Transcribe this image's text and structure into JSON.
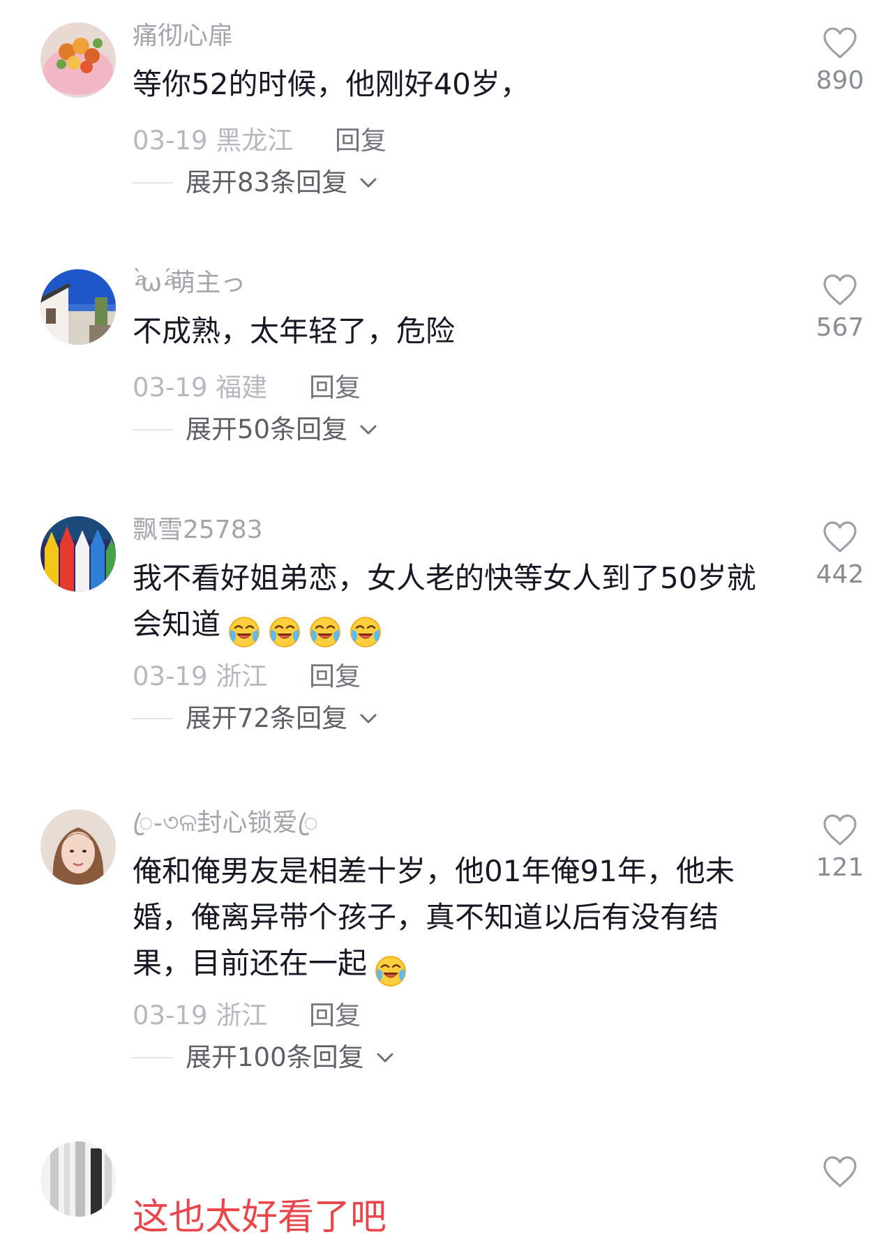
{
  "comments": [
    {
      "username": "痛彻心扉",
      "text": "等你52的时候，他刚好40岁，",
      "date": "03-19",
      "location": "黑龙江",
      "reply": "回复",
      "expand": "展开83条回复",
      "likes": "890"
    },
    {
      "username": "·ͣ̀ω·ͣ́萌主っ",
      "text": "不成熟，太年轻了，危险",
      "date": "03-19",
      "location": "福建",
      "reply": "回复",
      "expand": "展开50条回复",
      "likes": "567"
    },
    {
      "username": "飘雪25783",
      "text": "我不看好姐弟恋，女人老的快等女人到了50岁就会知道",
      "emoji_count": 4,
      "date": "03-19",
      "location": "浙江",
      "reply": "回复",
      "expand": "展开72条回复",
      "likes": "442"
    },
    {
      "username": "ꦿ֊৩ଳ封心锁爱ꦿ",
      "text": "俺和俺男友是相差十岁，他01年俺91年，他未婚，俺离异带个孩子，真不知道以后有没有结果，目前还在一起",
      "emoji_count": 1,
      "date": "03-19",
      "location": "浙江",
      "reply": "回复",
      "expand": "展开100条回复",
      "likes": "121"
    },
    {
      "text": "这也太好看了吧"
    }
  ],
  "icons": {
    "like": "heart-outline-icon",
    "expand": "chevron-down-icon",
    "emoji": "crying-laughing-emoji"
  },
  "colors": {
    "username": "#a3a5ac",
    "meta": "#b6b8bf",
    "highlight_text": "#e8464b"
  }
}
